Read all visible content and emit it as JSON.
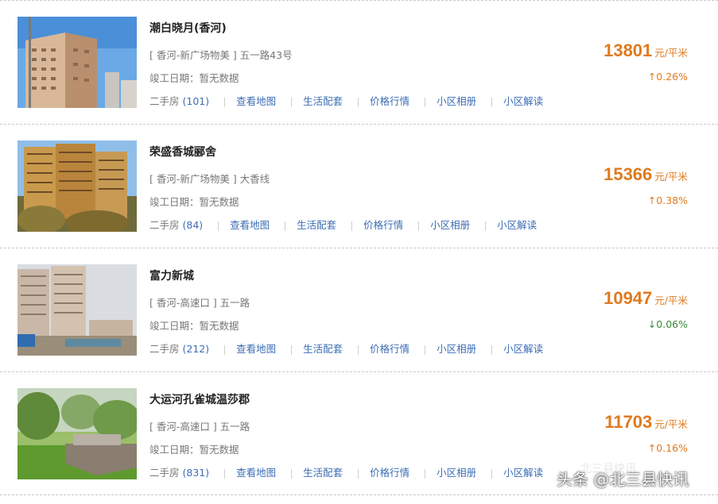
{
  "listings": [
    {
      "name": "潮白晓月(香河)",
      "address": "[ 香河-新广场物美 ] 五一路43号",
      "completion": "竣工日期：暂无数据",
      "secondhand_label": "二手房",
      "secondhand_count": "(101)",
      "links": [
        "查看地图",
        "生活配套",
        "价格行情",
        "小区相册",
        "小区解读"
      ],
      "price": "13801",
      "unit": "元/平米",
      "change": "↑0.26%",
      "trend": "up"
    },
    {
      "name": "荣盛香城郦舍",
      "address": "[ 香河-新广场物美 ] 大香线",
      "completion": "竣工日期：暂无数据",
      "secondhand_label": "二手房",
      "secondhand_count": "(84)",
      "links": [
        "查看地图",
        "生活配套",
        "价格行情",
        "小区相册",
        "小区解读"
      ],
      "price": "15366",
      "unit": "元/平米",
      "change": "↑0.38%",
      "trend": "up"
    },
    {
      "name": "富力新城",
      "address": "[ 香河-高速口 ] 五一路",
      "completion": "竣工日期：暂无数据",
      "secondhand_label": "二手房",
      "secondhand_count": "(212)",
      "links": [
        "查看地图",
        "生活配套",
        "价格行情",
        "小区相册",
        "小区解读"
      ],
      "price": "10947",
      "unit": "元/平米",
      "change": "↓0.06%",
      "trend": "down"
    },
    {
      "name": "大运河孔雀城温莎郡",
      "address": "[ 香河-高速口 ] 五一路",
      "completion": "竣工日期：暂无数据",
      "secondhand_label": "二手房",
      "secondhand_count": "(831)",
      "links": [
        "查看地图",
        "生活配套",
        "价格行情",
        "小区相册",
        "小区解读"
      ],
      "price": "11703",
      "unit": "元/平米",
      "change": "↑0.16%",
      "trend": "up"
    }
  ],
  "watermark": "头条 @北三县快讯",
  "watermark_faint": "北三县快讯",
  "colors": {
    "price": "#e07a1e",
    "link": "#3c6eb4",
    "down": "#3a8a3a"
  }
}
